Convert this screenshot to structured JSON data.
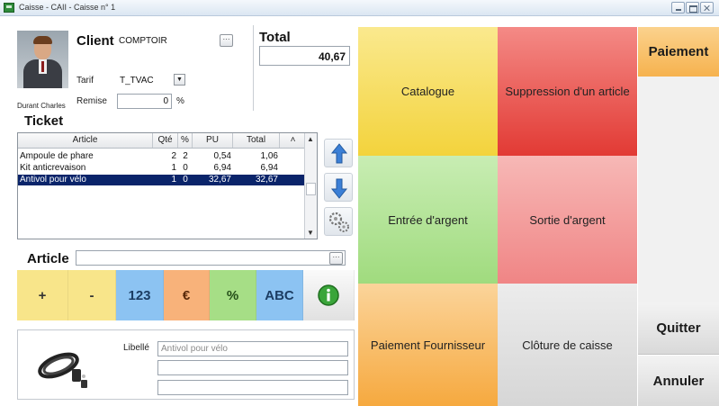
{
  "window": {
    "title": "Caisse - CAII - Caisse n° 1"
  },
  "client": {
    "photo_name": "Durant Charles",
    "label": "Client",
    "value": "COMPTOIR",
    "tarif_label": "Tarif",
    "tarif_value": "T_TVAC",
    "remise_label": "Remise",
    "remise_value": "0",
    "remise_unit": "%"
  },
  "total": {
    "label": "Total",
    "value": "40,67"
  },
  "ticket": {
    "label": "Ticket",
    "columns": [
      "Article",
      "Qté",
      "%",
      "PU",
      "Total"
    ],
    "rows": [
      {
        "article": "Ampoule de phare",
        "qty": "2",
        "pct": "2",
        "pu": "0,54",
        "total": "1,06"
      },
      {
        "article": "Kit anticrevaison",
        "qty": "1",
        "pct": "0",
        "pu": "6,94",
        "total": "6,94"
      },
      {
        "article": "Antivol pour vélo",
        "qty": "1",
        "pct": "0",
        "pu": "32,67",
        "total": "32,67"
      }
    ]
  },
  "article": {
    "label": "Article",
    "value": ""
  },
  "keypad": {
    "plus": "+",
    "minus": "-",
    "num": "123",
    "euro": "€",
    "percent": "%",
    "abc": "ABC"
  },
  "detail": {
    "libelle_label": "Libellé",
    "libelle_value": "Antivol pour vélo",
    "line2": "",
    "line3": ""
  },
  "tiles": {
    "catalogue": "Catalogue",
    "suppression": "Suppression d'un article",
    "entree": "Entrée d'argent",
    "sortie": "Sortie d'argent",
    "paiement_fournisseur": "Paiement Fournisseur",
    "cloture": "Clôture de caisse"
  },
  "actions": {
    "paiement": "Paiement",
    "quitter": "Quitter",
    "annuler": "Annuler"
  },
  "colors": {
    "yellow": "#f3d33c",
    "red": "#e4443e",
    "green": "#a6de86",
    "pink": "#f28c8c",
    "orange": "#f8b24d",
    "grey": "#dedede",
    "blue_key": "#8cc3f2",
    "selection": "#0a246a"
  }
}
